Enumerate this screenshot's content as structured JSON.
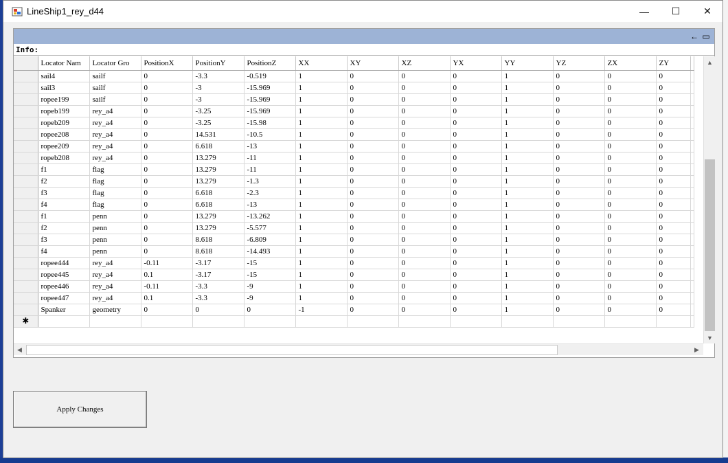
{
  "window": {
    "title": "LineShip1_rey_d44",
    "minimize_label": "—",
    "maximize_label": "☐",
    "close_label": "✕"
  },
  "caption": {
    "back_icon": "←",
    "layout_icon": "▭"
  },
  "info": {
    "label": "Info:"
  },
  "table": {
    "headers": [
      "Locator Nam",
      "Locator Gro",
      "PositionX",
      "PositionY",
      "PositionZ",
      "XX",
      "XY",
      "XZ",
      "YX",
      "YY",
      "YZ",
      "ZX",
      "ZY"
    ],
    "rows": [
      [
        "sail4",
        "sailf",
        "0",
        "-3.3",
        "-0.519",
        "1",
        "0",
        "0",
        "0",
        "1",
        "0",
        "0",
        "0"
      ],
      [
        "sail3",
        "sailf",
        "0",
        "-3",
        "-15.969",
        "1",
        "0",
        "0",
        "0",
        "1",
        "0",
        "0",
        "0"
      ],
      [
        "ropee199",
        "sailf",
        "0",
        "-3",
        "-15.969",
        "1",
        "0",
        "0",
        "0",
        "1",
        "0",
        "0",
        "0"
      ],
      [
        "ropeb199",
        "rey_a4",
        "0",
        "-3.25",
        "-15.969",
        "1",
        "0",
        "0",
        "0",
        "1",
        "0",
        "0",
        "0"
      ],
      [
        "ropeb209",
        "rey_a4",
        "0",
        "-3.25",
        "-15.98",
        "1",
        "0",
        "0",
        "0",
        "1",
        "0",
        "0",
        "0"
      ],
      [
        "ropee208",
        "rey_a4",
        "0",
        "14.531",
        "-10.5",
        "1",
        "0",
        "0",
        "0",
        "1",
        "0",
        "0",
        "0"
      ],
      [
        "ropee209",
        "rey_a4",
        "0",
        "6.618",
        "-13",
        "1",
        "0",
        "0",
        "0",
        "1",
        "0",
        "0",
        "0"
      ],
      [
        "ropeb208",
        "rey_a4",
        "0",
        "13.279",
        "-11",
        "1",
        "0",
        "0",
        "0",
        "1",
        "0",
        "0",
        "0"
      ],
      [
        "f1",
        "flag",
        "0",
        "13.279",
        "-11",
        "1",
        "0",
        "0",
        "0",
        "1",
        "0",
        "0",
        "0"
      ],
      [
        "f2",
        "flag",
        "0",
        "13.279",
        "-1.3",
        "1",
        "0",
        "0",
        "0",
        "1",
        "0",
        "0",
        "0"
      ],
      [
        "f3",
        "flag",
        "0",
        "6.618",
        "-2.3",
        "1",
        "0",
        "0",
        "0",
        "1",
        "0",
        "0",
        "0"
      ],
      [
        "f4",
        "flag",
        "0",
        "6.618",
        "-13",
        "1",
        "0",
        "0",
        "0",
        "1",
        "0",
        "0",
        "0"
      ],
      [
        "f1",
        "penn",
        "0",
        "13.279",
        "-13.262",
        "1",
        "0",
        "0",
        "0",
        "1",
        "0",
        "0",
        "0"
      ],
      [
        "f2",
        "penn",
        "0",
        "13.279",
        "-5.577",
        "1",
        "0",
        "0",
        "0",
        "1",
        "0",
        "0",
        "0"
      ],
      [
        "f3",
        "penn",
        "0",
        "8.618",
        "-6.809",
        "1",
        "0",
        "0",
        "0",
        "1",
        "0",
        "0",
        "0"
      ],
      [
        "f4",
        "penn",
        "0",
        "8.618",
        "-14.493",
        "1",
        "0",
        "0",
        "0",
        "1",
        "0",
        "0",
        "0"
      ],
      [
        "ropee444",
        "rey_a4",
        "-0.11",
        "-3.17",
        "-15",
        "1",
        "0",
        "0",
        "0",
        "1",
        "0",
        "0",
        "0"
      ],
      [
        "ropee445",
        "rey_a4",
        "0.1",
        "-3.17",
        "-15",
        "1",
        "0",
        "0",
        "0",
        "1",
        "0",
        "0",
        "0"
      ],
      [
        "ropee446",
        "rey_a4",
        "-0.11",
        "-3.3",
        "-9",
        "1",
        "0",
        "0",
        "0",
        "1",
        "0",
        "0",
        "0"
      ],
      [
        "ropee447",
        "rey_a4",
        "0.1",
        "-3.3",
        "-9",
        "1",
        "0",
        "0",
        "0",
        "1",
        "0",
        "0",
        "0"
      ],
      [
        "Spanker",
        "geometry",
        "0",
        "0",
        "0",
        "-1",
        "0",
        "0",
        "0",
        "1",
        "0",
        "0",
        "0"
      ]
    ],
    "new_row_marker": "✱"
  },
  "scroll": {
    "up": "▲",
    "down": "▼",
    "left": "◀",
    "right": "▶"
  },
  "apply_button": {
    "label": "Apply Changes"
  }
}
